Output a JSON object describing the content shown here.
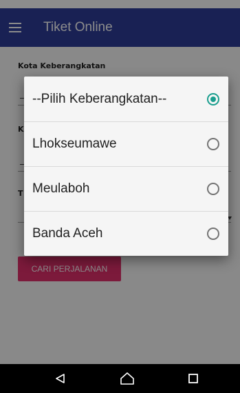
{
  "app_bar": {
    "title": "Tiket Online",
    "menu_icon": "hamburger-menu-icon",
    "color": "#2e3d9a"
  },
  "form": {
    "origin_label": "Kota Keberangkatan",
    "destination_label_partial": "K",
    "date_label_partial": "T",
    "origin_value_partial": "-",
    "destination_value_partial": "-"
  },
  "search_button": {
    "label": "CARI PERJALANAN",
    "color": "#e2306c"
  },
  "dialog": {
    "selected_index": 0,
    "accent_color": "#1a9e8e",
    "options": [
      {
        "label": "--Pilih Keberangkatan--",
        "checked": true
      },
      {
        "label": "Lhokseumawe",
        "checked": false
      },
      {
        "label": "Meulaboh",
        "checked": false
      },
      {
        "label": "Banda Aceh",
        "checked": false
      }
    ]
  },
  "nav_bar": {
    "back_icon": "back-triangle-icon",
    "home_icon": "home-icon",
    "recents_icon": "recents-square-icon"
  }
}
